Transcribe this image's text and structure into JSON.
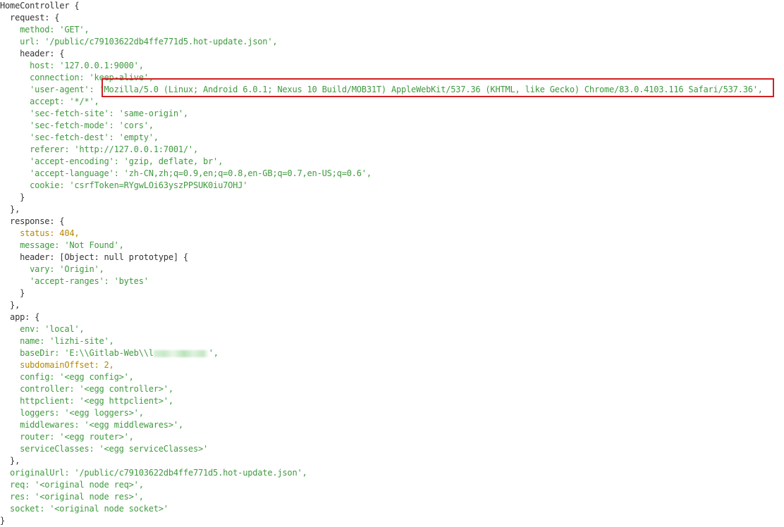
{
  "console": {
    "lines": [
      "HomeController {",
      "  request: {",
      "    method: 'GET',",
      "    url: '/public/c79103622db4ffe771d5.hot-update.json',",
      "    header: {",
      "      host: '127.0.0.1:9000',",
      "      connection: 'keep-alive',",
      "      'user-agent': 'Mozilla/5.0 (Linux; Android 6.0.1; Nexus 10 Build/MOB31T) AppleWebKit/537.36 (KHTML, like Gecko) Chrome/83.0.4103.116 Safari/537.36',",
      "      accept: '*/*',",
      "      'sec-fetch-site': 'same-origin',",
      "      'sec-fetch-mode': 'cors',",
      "      'sec-fetch-dest': 'empty',",
      "      referer: 'http://127.0.0.1:7001/',",
      "      'accept-encoding': 'gzip, deflate, br',",
      "      'accept-language': 'zh-CN,zh;q=0.9,en;q=0.8,en-GB;q=0.7,en-US;q=0.6',",
      "      cookie: 'csrfToken=RYgwLOi63yszPPSUK0iu7OHJ'",
      "    }",
      "  },",
      "  response: {",
      "    status: 404,",
      "    message: 'Not Found',",
      "    header: [Object: null prototype] {",
      "      vary: 'Origin',",
      "      'accept-ranges': 'bytes'",
      "    }",
      "  },",
      "  app: {",
      "    env: 'local',",
      "    name: 'lizhi-site',",
      "    baseDir: 'E:\\\\Gitlab-Web\\\\l",
      "    subdomainOffset: 2,",
      "    config: '<egg config>',",
      "    controller: '<egg controller>',",
      "    httpclient: '<egg httpclient>',",
      "    loggers: '<egg loggers>',",
      "    middlewares: '<egg middlewares>',",
      "    router: '<egg router>',",
      "    serviceClasses: '<egg serviceClasses>'",
      "  },",
      "  originalUrl: '/public/c79103622db4ffe771d5.hot-update.json',",
      "  req: '<original node req>',",
      "  res: '<original node res>',",
      "  socket: '<original node socket>'",
      "}"
    ],
    "redacted_suffix": "',",
    "highlight": {
      "line_index": 7,
      "color": "#d21f1f"
    },
    "colors": {
      "string": "#3f9a3f",
      "number": "#b58900",
      "text": "#333333",
      "background": "#ffffff"
    }
  }
}
